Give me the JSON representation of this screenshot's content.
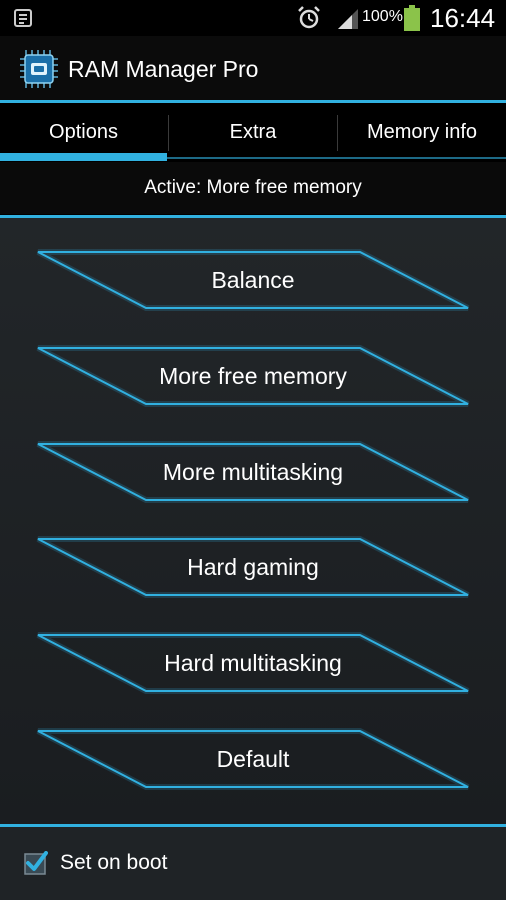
{
  "status_bar": {
    "battery_percent": "100%",
    "time": "16:44",
    "icons": [
      "notification-list-icon",
      "alarm-icon",
      "signal-icon",
      "battery-icon"
    ]
  },
  "app": {
    "title": "RAM Manager Pro",
    "icon": "chip-icon"
  },
  "tabs": [
    {
      "label": "Options",
      "selected": true
    },
    {
      "label": "Extra",
      "selected": false
    },
    {
      "label": "Memory info",
      "selected": false
    }
  ],
  "active": {
    "text": "Active: More free memory"
  },
  "options": [
    {
      "label": "Balance"
    },
    {
      "label": "More free memory"
    },
    {
      "label": "More multitasking"
    },
    {
      "label": "Hard gaming"
    },
    {
      "label": "Hard multitasking"
    },
    {
      "label": "Default"
    }
  ],
  "footer": {
    "set_on_boot_label": "Set on boot",
    "set_on_boot_checked": true
  },
  "colors": {
    "accent": "#31b1e0",
    "background": "#000000",
    "panel": "#222629"
  }
}
